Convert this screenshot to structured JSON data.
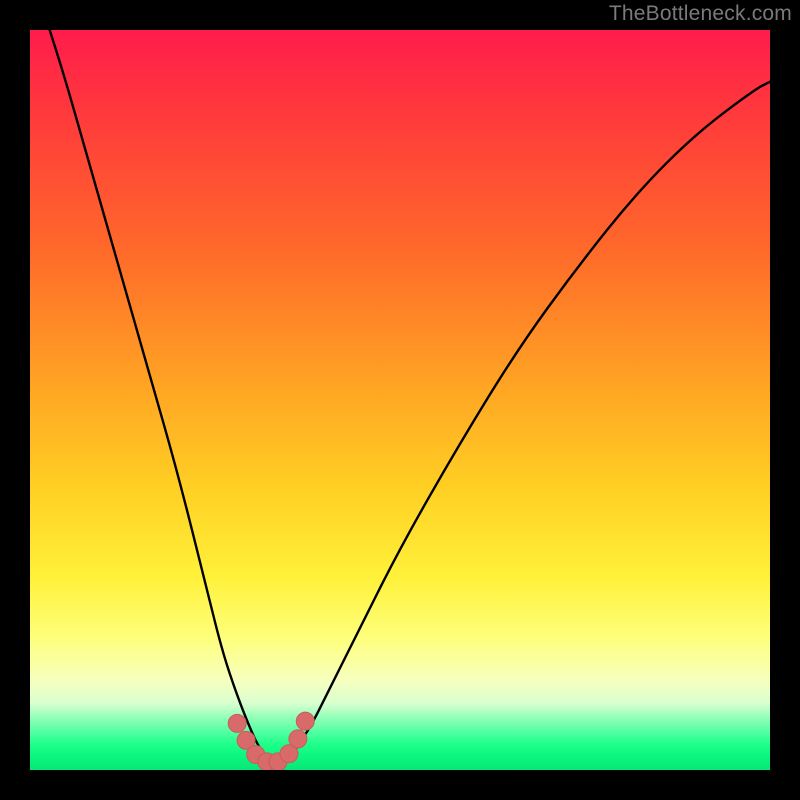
{
  "watermark": "TheBottleneck.com",
  "colors": {
    "curve_stroke": "#000000",
    "marker_fill": "#d96a6a",
    "marker_stroke": "#c95b5b",
    "frame": "#000000"
  },
  "chart_data": {
    "type": "line",
    "title": "",
    "xlabel": "",
    "ylabel": "",
    "xlim": [
      0,
      100
    ],
    "ylim": [
      0,
      100
    ],
    "grid": false,
    "legend": false,
    "note": "Axes are unlabeled in the source image; x/y values below are estimated in percent of plot width/height (0 at left/bottom).",
    "series": [
      {
        "name": "bottleneck-curve",
        "x": [
          0,
          4,
          8,
          12,
          16,
          20,
          24,
          26,
          28,
          30,
          31,
          32,
          33,
          34,
          35,
          36,
          38,
          40,
          44,
          50,
          58,
          66,
          74,
          82,
          90,
          98,
          100
        ],
        "y": [
          108,
          96,
          82,
          68,
          54,
          40,
          24,
          16,
          10,
          5,
          3,
          1.5,
          1,
          1,
          1.5,
          3,
          6,
          10,
          18,
          30,
          44,
          57,
          68,
          78,
          86,
          92,
          93
        ]
      }
    ],
    "markers": {
      "name": "highlight-dots",
      "x": [
        28.0,
        29.2,
        30.5,
        32.0,
        33.5,
        35.0,
        36.2,
        37.2
      ],
      "y": [
        6.3,
        4.0,
        2.1,
        1.1,
        1.1,
        2.2,
        4.2,
        6.6
      ]
    }
  }
}
